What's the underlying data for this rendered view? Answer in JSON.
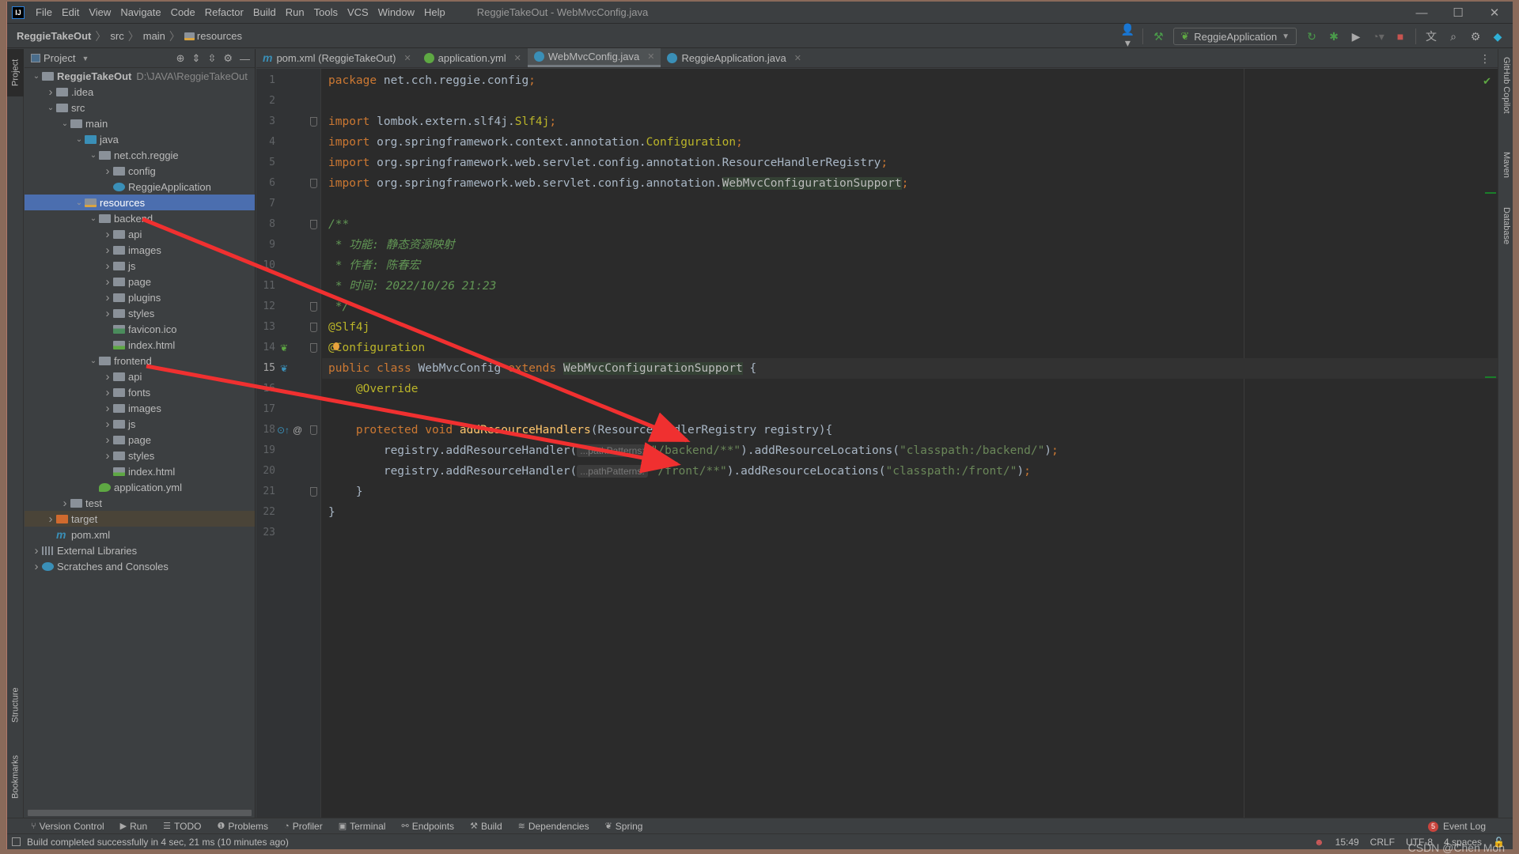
{
  "window": {
    "title": "ReggieTakeOut - WebMvcConfig.java",
    "app_logo": "IJ",
    "controls": [
      "minimize",
      "maximize",
      "close"
    ]
  },
  "menu": [
    "File",
    "Edit",
    "View",
    "Navigate",
    "Code",
    "Refactor",
    "Build",
    "Run",
    "Tools",
    "VCS",
    "Window",
    "Help"
  ],
  "breadcrumb": [
    "ReggieTakeOut",
    "src",
    "main",
    "resources"
  ],
  "toolbar": {
    "run_config": "ReggieApplication",
    "icons": [
      "user-icon",
      "build-hammer-icon",
      "rerun-icon",
      "debug-icon",
      "coverage-icon",
      "profile-icon",
      "stop-icon",
      "translate-icon",
      "search-icon",
      "settings-icon",
      "plugin-icon"
    ]
  },
  "left_strip": {
    "project": "Project",
    "structure": "Structure",
    "bookmarks": "Bookmarks"
  },
  "right_strip": {
    "copilot": "GitHub Copilot",
    "maven": "Maven",
    "database": "Database"
  },
  "project_panel": {
    "title": "Project",
    "tree": [
      {
        "label": "ReggieTakeOut",
        "path": "D:\\JAVA\\ReggieTakeOut",
        "depth": 0,
        "arrow": "open",
        "icon": "module",
        "bold": true
      },
      {
        "label": ".idea",
        "depth": 1,
        "arrow": "closed",
        "icon": "folder"
      },
      {
        "label": "src",
        "depth": 1,
        "arrow": "open",
        "icon": "folder"
      },
      {
        "label": "main",
        "depth": 2,
        "arrow": "open",
        "icon": "folder"
      },
      {
        "label": "java",
        "depth": 3,
        "arrow": "open",
        "icon": "folder-src"
      },
      {
        "label": "net.cch.reggie",
        "depth": 4,
        "arrow": "open",
        "icon": "pkg"
      },
      {
        "label": "config",
        "depth": 5,
        "arrow": "closed",
        "icon": "pkg"
      },
      {
        "label": "ReggieApplication",
        "depth": 5,
        "arrow": "none",
        "icon": "app"
      },
      {
        "label": "resources",
        "depth": 3,
        "arrow": "open",
        "icon": "folder-res",
        "selected": true
      },
      {
        "label": "backend",
        "depth": 4,
        "arrow": "open",
        "icon": "folder"
      },
      {
        "label": "api",
        "depth": 5,
        "arrow": "closed",
        "icon": "folder"
      },
      {
        "label": "images",
        "depth": 5,
        "arrow": "closed",
        "icon": "folder"
      },
      {
        "label": "js",
        "depth": 5,
        "arrow": "closed",
        "icon": "folder"
      },
      {
        "label": "page",
        "depth": 5,
        "arrow": "closed",
        "icon": "folder"
      },
      {
        "label": "plugins",
        "depth": 5,
        "arrow": "closed",
        "icon": "folder"
      },
      {
        "label": "styles",
        "depth": 5,
        "arrow": "closed",
        "icon": "folder"
      },
      {
        "label": "favicon.ico",
        "depth": 5,
        "arrow": "none",
        "icon": "file"
      },
      {
        "label": "index.html",
        "depth": 5,
        "arrow": "none",
        "icon": "html"
      },
      {
        "label": "frontend",
        "depth": 4,
        "arrow": "open",
        "icon": "folder"
      },
      {
        "label": "api",
        "depth": 5,
        "arrow": "closed",
        "icon": "folder"
      },
      {
        "label": "fonts",
        "depth": 5,
        "arrow": "closed",
        "icon": "folder"
      },
      {
        "label": "images",
        "depth": 5,
        "arrow": "closed",
        "icon": "folder"
      },
      {
        "label": "js",
        "depth": 5,
        "arrow": "closed",
        "icon": "folder"
      },
      {
        "label": "page",
        "depth": 5,
        "arrow": "closed",
        "icon": "folder"
      },
      {
        "label": "styles",
        "depth": 5,
        "arrow": "closed",
        "icon": "folder"
      },
      {
        "label": "index.html",
        "depth": 5,
        "arrow": "none",
        "icon": "html"
      },
      {
        "label": "application.yml",
        "depth": 4,
        "arrow": "none",
        "icon": "spring"
      },
      {
        "label": "test",
        "depth": 2,
        "arrow": "closed",
        "icon": "folder"
      },
      {
        "label": "target",
        "depth": 1,
        "arrow": "closed",
        "icon": "folder-target",
        "excluded": true
      },
      {
        "label": "pom.xml",
        "depth": 1,
        "arrow": "none",
        "icon": "maven"
      },
      {
        "label": "External Libraries",
        "depth": 0,
        "arrow": "closed",
        "icon": "libs"
      },
      {
        "label": "Scratches and Consoles",
        "depth": 0,
        "arrow": "closed",
        "icon": "scratch"
      }
    ]
  },
  "tabs": [
    {
      "label": "pom.xml (ReggieTakeOut)",
      "icon": "maven",
      "active": false
    },
    {
      "label": "application.yml",
      "icon": "spring",
      "active": false
    },
    {
      "label": "WebMvcConfig.java",
      "icon": "class",
      "active": true
    },
    {
      "label": "ReggieApplication.java",
      "icon": "app",
      "active": false
    }
  ],
  "editor": {
    "current_line": 15,
    "lines": [
      [
        [
          "kw",
          "package "
        ],
        [
          "pl",
          "net.cch.reggie.config"
        ],
        [
          "kw",
          ";"
        ]
      ],
      [],
      [
        [
          "kw",
          "import "
        ],
        [
          "pl",
          "lombok.extern.slf4j."
        ],
        [
          "ann",
          "Slf4j"
        ],
        [
          "kw",
          ";"
        ]
      ],
      [
        [
          "kw",
          "import "
        ],
        [
          "pl",
          "org.springframework.context.annotation."
        ],
        [
          "ann",
          "Configuration"
        ],
        [
          "kw",
          ";"
        ]
      ],
      [
        [
          "kw",
          "import "
        ],
        [
          "pl",
          "org.springframework.web.servlet.config.annotation.ResourceHandlerRegistry"
        ],
        [
          "kw",
          ";"
        ]
      ],
      [
        [
          "kw",
          "import "
        ],
        [
          "pl",
          "org.springframework.web.servlet.config.annotation."
        ],
        [
          "hl",
          "WebMvcConfigurationSupport"
        ],
        [
          "kw",
          ";"
        ]
      ],
      [],
      [
        [
          "cm",
          "/**"
        ]
      ],
      [
        [
          "cm",
          " * 功能: 静态资源映射"
        ]
      ],
      [
        [
          "cm",
          " * 作者: 陈春宏"
        ]
      ],
      [
        [
          "cm",
          " * 时间: 2022/10/26 21:23"
        ]
      ],
      [
        [
          "cm",
          " */"
        ]
      ],
      [
        [
          "ann",
          "@Slf4j"
        ]
      ],
      [
        [
          "ann",
          "@Configuration"
        ]
      ],
      [
        [
          "kw",
          "public class "
        ],
        [
          "pl",
          "WebMvcConfig "
        ],
        [
          "kw",
          "extends "
        ],
        [
          "hl",
          "WebMvcConfigurationSupport"
        ],
        [
          "pl",
          " {"
        ]
      ],
      [
        [
          "pl",
          "    "
        ],
        [
          "ann",
          "@Override"
        ]
      ],
      [],
      [
        [
          "pl",
          "    "
        ],
        [
          "kw",
          "protected void "
        ],
        [
          "fn",
          "addResourceHandlers"
        ],
        [
          "pl",
          "(ResourceHandlerRegistry registry){"
        ]
      ],
      [
        [
          "pl",
          "        registry.addResourceHandler("
        ],
        [
          "hint",
          "...pathPatterns:"
        ],
        [
          "str",
          "\"/backend/**\""
        ],
        [
          "pl",
          ").addResourceLocations("
        ],
        [
          "str",
          "\"classpath:/backend/\""
        ],
        [
          "pl",
          ")"
        ],
        [
          "kw",
          ";"
        ]
      ],
      [
        [
          "pl",
          "        registry.addResourceHandler("
        ],
        [
          "hint",
          "...pathPatterns:"
        ],
        [
          "str",
          "\"/front/**\""
        ],
        [
          "pl",
          ").addResourceLocations("
        ],
        [
          "str",
          "\"classpath:/front/\""
        ],
        [
          "pl",
          ")"
        ],
        [
          "kw",
          ";"
        ]
      ],
      [
        [
          "pl",
          "    }"
        ]
      ],
      [
        [
          "pl",
          "}"
        ]
      ],
      []
    ],
    "folds": [
      3,
      6,
      8,
      12,
      13,
      14,
      18,
      21
    ]
  },
  "tool_windows": [
    {
      "label": "Version Control",
      "icon": "⑂"
    },
    {
      "label": "Run",
      "icon": "▶"
    },
    {
      "label": "TODO",
      "icon": "☰"
    },
    {
      "label": "Problems",
      "icon": "❶"
    },
    {
      "label": "Profiler",
      "icon": "◔"
    },
    {
      "label": "Terminal",
      "icon": "▣"
    },
    {
      "label": "Endpoints",
      "icon": "⚯"
    },
    {
      "label": "Build",
      "icon": "⚒"
    },
    {
      "label": "Dependencies",
      "icon": "≋"
    },
    {
      "label": "Spring",
      "icon": "❦"
    }
  ],
  "event_log": {
    "label": "Event Log",
    "count": "5"
  },
  "status": {
    "message": "Build completed successfully in 4 sec, 21 ms (10 minutes ago)",
    "position": "15:49",
    "line_sep": "CRLF",
    "encoding": "UTF-8",
    "indent": "4 spaces"
  },
  "watermark": "CSDN @Chen Mon",
  "annotation": {
    "color": "#f03030"
  }
}
